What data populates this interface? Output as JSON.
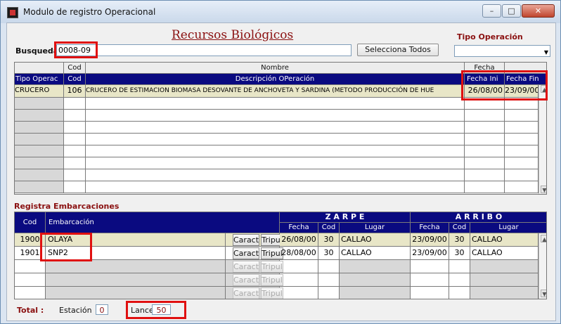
{
  "window": {
    "title": "Modulo de registro Operacional"
  },
  "heading": "Recursos Biológicos",
  "search": {
    "label": "Busqueda",
    "value": "0008-09",
    "button": "Selecciona Todos"
  },
  "tipo_operacion": {
    "label": "Tipo Operación",
    "value": ""
  },
  "ops_table": {
    "header_top": {
      "cod": "Cod",
      "nombre": "Nombre",
      "fecha": "Fecha"
    },
    "header": [
      "Tipo Operac",
      "Cod",
      "Descripción OPeración",
      "Fecha Ini",
      "Fecha Fin"
    ],
    "rows": [
      {
        "tipo": "CRUCERO",
        "cod": "106",
        "desc": "CRUCERO DE ESTIMACION BIOMASA DESOVANTE DE ANCHOVETA Y SARDINA (METODO PRODUCCIÓN DE HUE",
        "ini": "26/08/00",
        "fin": "23/09/00"
      }
    ]
  },
  "embarcaciones": {
    "section_label": "Registra Embarcaciones",
    "zarpe": "Z A R P E",
    "arribo": "A R R I B O",
    "header": {
      "cod": "Cod",
      "emb": "Embarcación",
      "fecha": "Fecha",
      "cod2": "Cod",
      "lugar": "Lugar"
    },
    "btn_caract": "Caract",
    "btn_tripul": "Tripul",
    "rows": [
      {
        "cod": "1900",
        "emb": "OLAYA",
        "z_fecha": "26/08/00",
        "z_cod": "30",
        "z_lugar": "CALLAO",
        "a_fecha": "23/09/00",
        "a_cod": "30",
        "a_lugar": "CALLAO"
      },
      {
        "cod": "1901",
        "emb": "SNP2",
        "z_fecha": "28/08/00",
        "z_cod": "30",
        "z_lugar": "CALLAO",
        "a_fecha": "23/09/00",
        "a_cod": "30",
        "a_lugar": "CALLAO"
      }
    ]
  },
  "totals": {
    "label": "Total :",
    "estacion_label": "Estación",
    "estacion": "0",
    "lance_label": "Lance",
    "lance": "50"
  }
}
